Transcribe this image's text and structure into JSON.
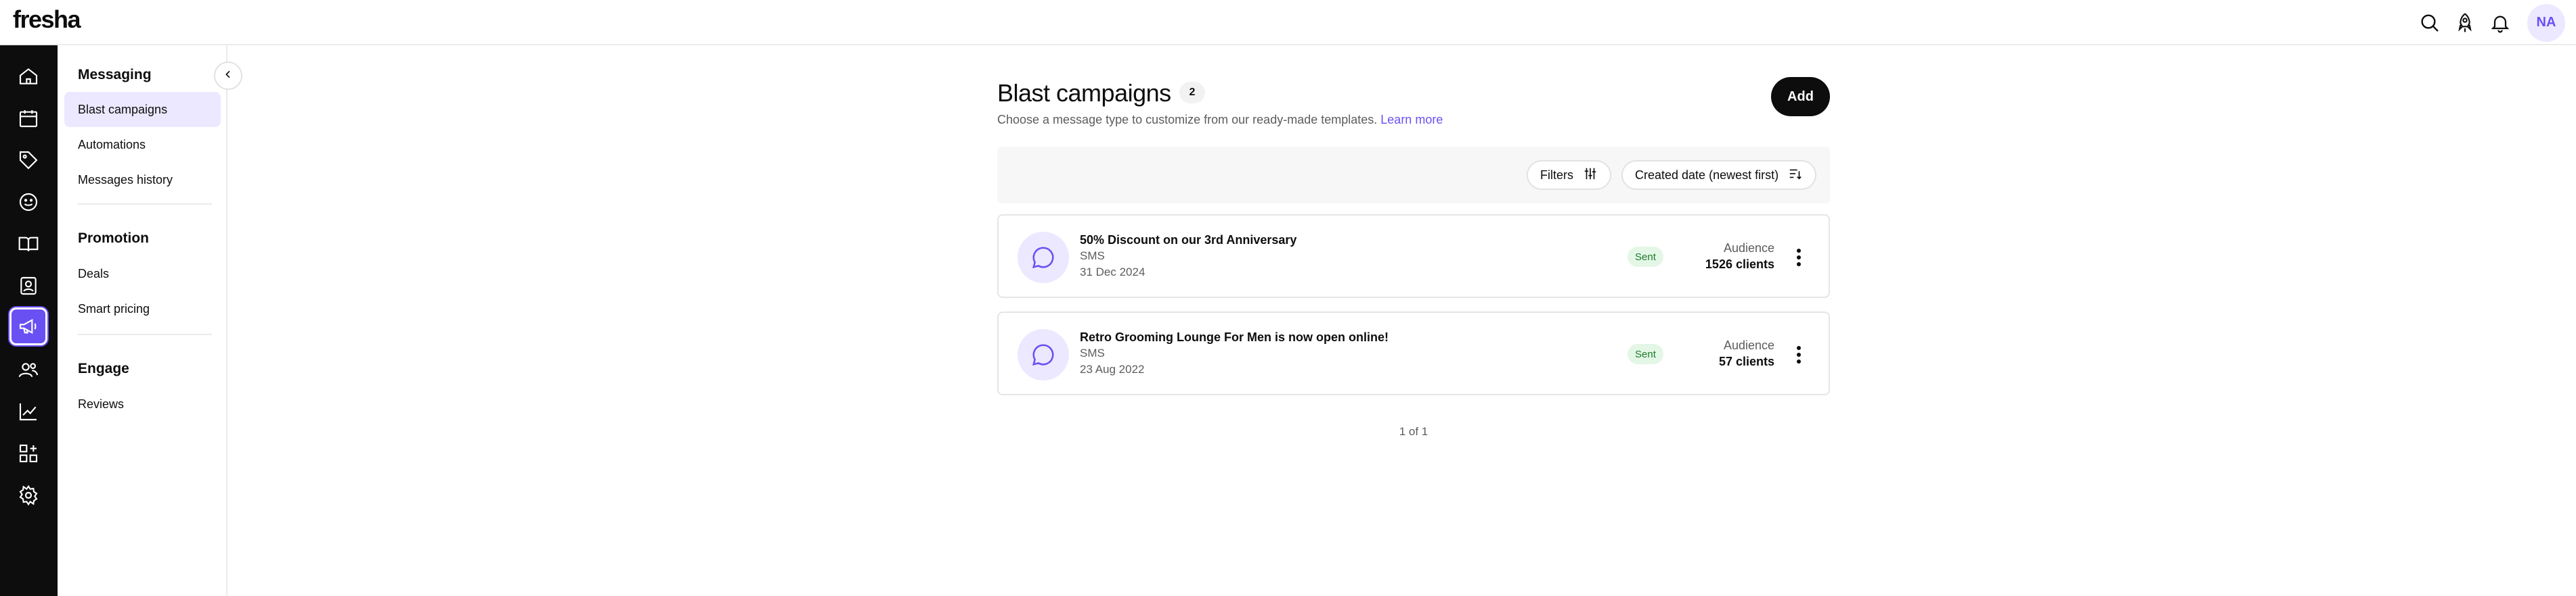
{
  "app": {
    "logo": "fresha"
  },
  "topbar": {
    "icons": [
      "search-icon",
      "rocket-icon",
      "bell-icon"
    ],
    "avatar_initials": "NA"
  },
  "rail": {
    "items": [
      "home-icon",
      "calendar-icon",
      "tag-icon",
      "smile-icon",
      "book-icon",
      "contact-card-icon",
      "megaphone-icon",
      "people-icon",
      "chart-icon",
      "apps-icon",
      "settings-icon"
    ],
    "active_index": 6
  },
  "subnav": {
    "sections": [
      {
        "title": "Messaging",
        "items": [
          {
            "label": "Blast campaigns",
            "active": true
          },
          {
            "label": "Automations"
          },
          {
            "label": "Messages history"
          }
        ]
      },
      {
        "title": "Promotion",
        "items": [
          {
            "label": "Deals"
          },
          {
            "label": "Smart pricing"
          }
        ]
      },
      {
        "title": "Engage",
        "items": [
          {
            "label": "Reviews"
          }
        ]
      }
    ]
  },
  "main": {
    "title": "Blast campaigns",
    "count": "2",
    "subtitle": "Choose a message type to customize from our ready-made templates.",
    "learn_more": "Learn more",
    "add_label": "Add",
    "filters_label": "Filters",
    "sort_label": "Created date (newest first)",
    "campaigns": [
      {
        "title": "50% Discount on our 3rd Anniversary",
        "channel": "SMS",
        "date": "31 Dec 2024",
        "status": "Sent",
        "audience_label": "Audience",
        "audience_value": "1526 clients"
      },
      {
        "title": "Retro Grooming Lounge For Men is now open online!",
        "channel": "SMS",
        "date": "23 Aug 2022",
        "status": "Sent",
        "audience_label": "Audience",
        "audience_value": "57 clients"
      }
    ],
    "pagination": "1 of 1"
  },
  "colors": {
    "accent": "#6950f3",
    "accent_soft": "#ece8ff",
    "rail_bg": "#0d0d0d",
    "status_bg": "#e4f7e6",
    "status_text": "#1d7a2c"
  }
}
